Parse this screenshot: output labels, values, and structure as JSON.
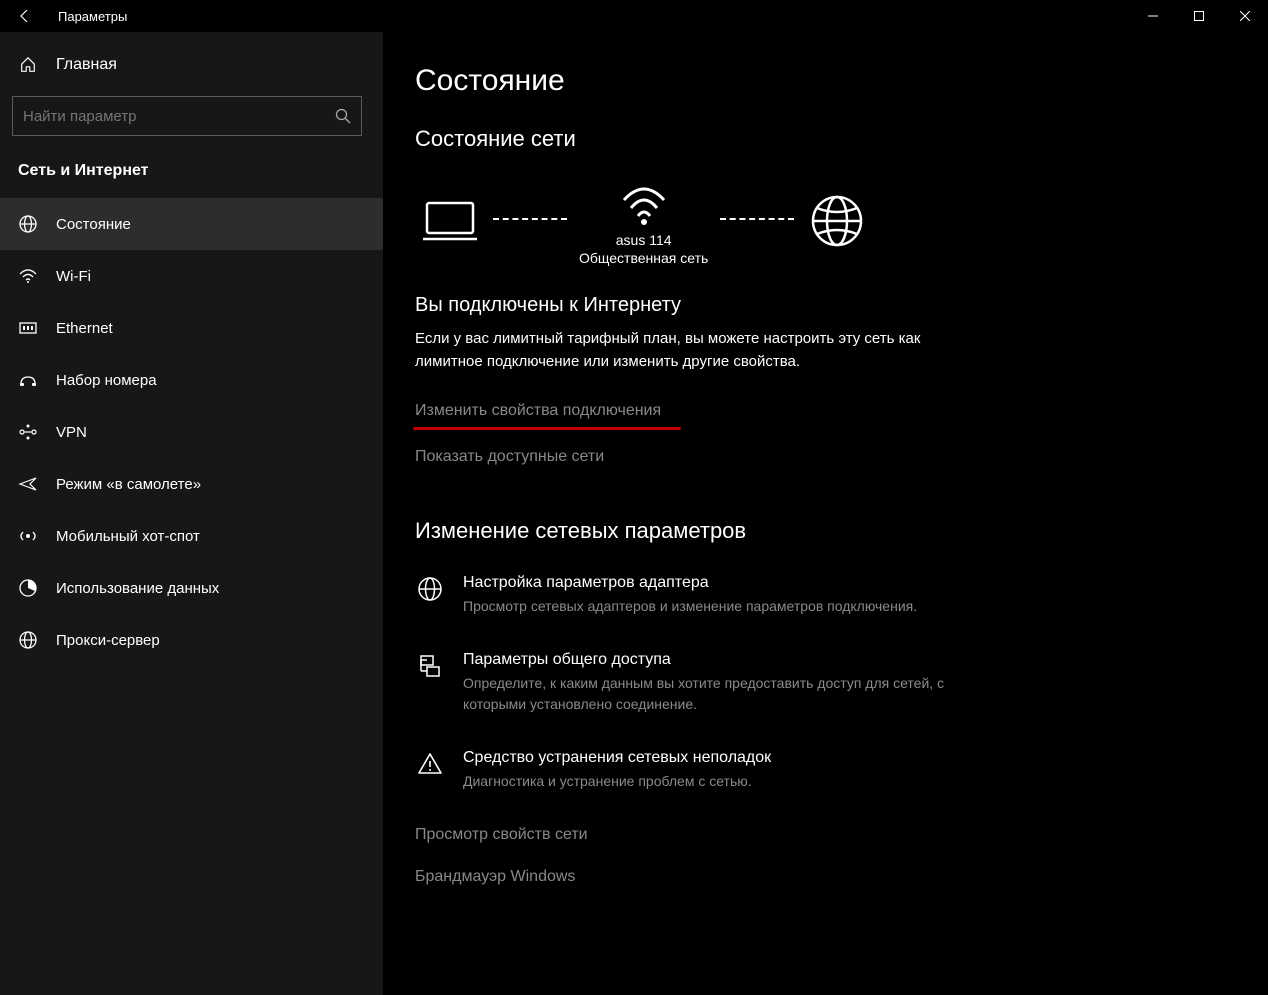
{
  "titlebar": {
    "title": "Параметры"
  },
  "sidebar": {
    "home_label": "Главная",
    "search_placeholder": "Найти параметр",
    "category": "Сеть и Интернет",
    "items": [
      {
        "label": "Состояние"
      },
      {
        "label": "Wi-Fi"
      },
      {
        "label": "Ethernet"
      },
      {
        "label": "Набор номера"
      },
      {
        "label": "VPN"
      },
      {
        "label": "Режим «в самолете»"
      },
      {
        "label": "Мобильный хот-спот"
      },
      {
        "label": "Использование данных"
      },
      {
        "label": "Прокси-сервер"
      }
    ]
  },
  "main": {
    "page_title": "Состояние",
    "network_status_title": "Состояние сети",
    "diagram": {
      "ssid": "asus 114",
      "network_type": "Общественная сеть"
    },
    "connected_heading": "Вы подключены к Интернету",
    "connected_desc": "Если у вас лимитный тарифный план, вы можете настроить эту сеть как лимитное подключение или изменить другие свойства.",
    "link_change_props": "Изменить свойства подключения",
    "link_show_networks": "Показать доступные сети",
    "change_settings_title": "Изменение сетевых параметров",
    "settings": [
      {
        "title": "Настройка параметров адаптера",
        "desc": "Просмотр сетевых адаптеров и изменение параметров подключения."
      },
      {
        "title": "Параметры общего доступа",
        "desc": "Определите, к каким данным вы хотите предоставить доступ для сетей, с которыми установлено соединение."
      },
      {
        "title": "Средство устранения сетевых неполадок",
        "desc": "Диагностика и устранение проблем с сетью."
      }
    ],
    "link_view_props": "Просмотр свойств сети",
    "link_firewall": "Брандмауэр Windows"
  }
}
